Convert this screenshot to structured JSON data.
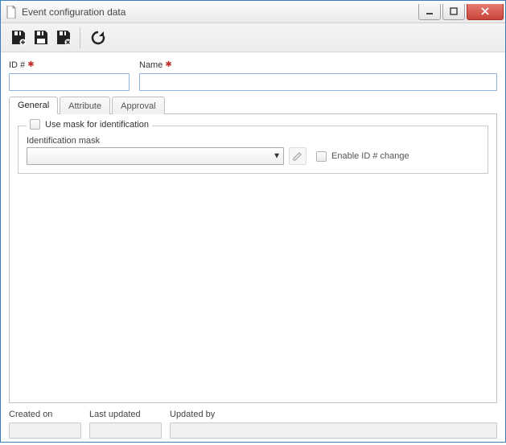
{
  "window": {
    "title": "Event configuration data"
  },
  "toolbar": {
    "save_add": "Save and add new",
    "save": "Save",
    "save_close": "Save and close",
    "refresh": "Refresh"
  },
  "fields": {
    "id": {
      "label": "ID #",
      "value": ""
    },
    "name": {
      "label": "Name",
      "value": ""
    }
  },
  "tabs": {
    "general": "General",
    "attribute": "Attribute",
    "approval": "Approval"
  },
  "general": {
    "use_mask_label": "Use mask for identification",
    "mask_label": "Identification mask",
    "mask_value": "",
    "edit_mask_tooltip": "Edit mask",
    "enable_id_change_label": "Enable ID # change"
  },
  "footer": {
    "created_on_label": "Created on",
    "created_on_value": "",
    "last_updated_label": "Last updated",
    "last_updated_value": "",
    "updated_by_label": "Updated by",
    "updated_by_value": ""
  }
}
